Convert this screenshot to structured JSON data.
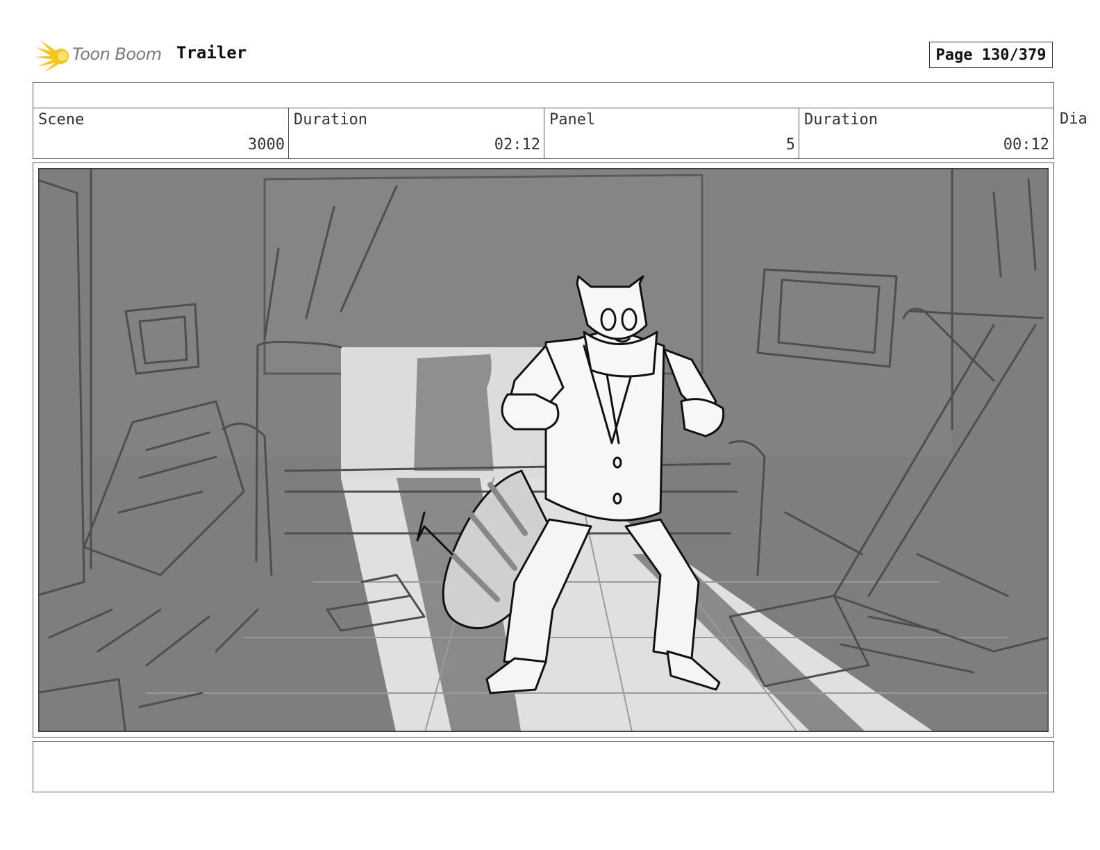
{
  "header": {
    "logo_text": "Toon Boom",
    "title": "Trailer",
    "page_indicator": "Page 130/379"
  },
  "info": {
    "scene_label": "Scene",
    "scene_value": "3000",
    "scene_duration_label": "Duration",
    "scene_duration_value": "02:12",
    "panel_label": "Panel",
    "panel_value": "5",
    "panel_duration_label": "Duration",
    "panel_duration_value": "00:12",
    "dialogue_label_partial": "Dia"
  },
  "notes": {
    "text": ""
  },
  "colors": {
    "sketch_dark": "#7d7d7d",
    "sketch_mid": "#939393",
    "sketch_light": "#e2e2e2",
    "logo_yellow": "#f5c518"
  }
}
